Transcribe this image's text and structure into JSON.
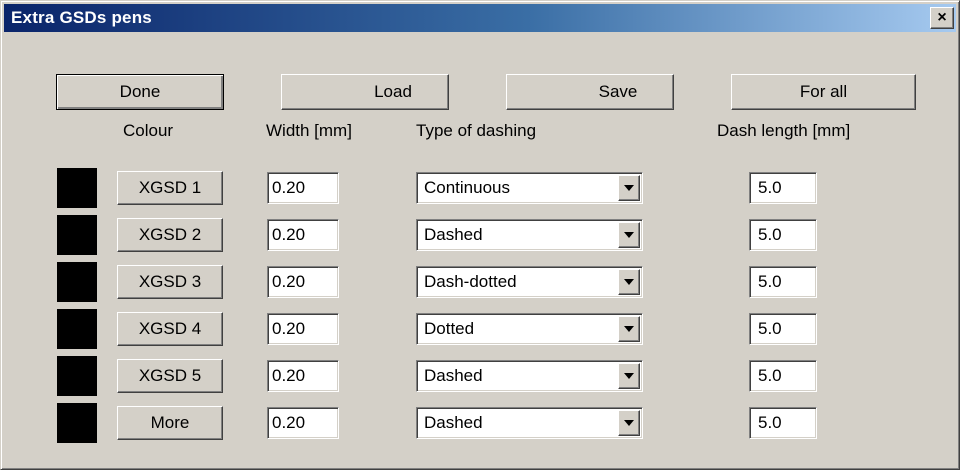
{
  "window": {
    "title": "Extra GSDs pens",
    "close_glyph": "×"
  },
  "toolbar": {
    "done": "Done",
    "load": "Load",
    "save": "Save",
    "for_all": "For all"
  },
  "headers": {
    "colour": "Colour",
    "width": "Width [mm]",
    "dashing": "Type of dashing",
    "dash_length": "Dash length [mm]"
  },
  "pens": [
    {
      "color": "#000000",
      "label": "XGSD 1",
      "width": "0.20",
      "dashing": "Continuous",
      "dash_length": "5.0"
    },
    {
      "color": "#000000",
      "label": "XGSD 2",
      "width": "0.20",
      "dashing": "Dashed",
      "dash_length": "5.0"
    },
    {
      "color": "#000000",
      "label": "XGSD 3",
      "width": "0.20",
      "dashing": "Dash-dotted",
      "dash_length": "5.0"
    },
    {
      "color": "#000000",
      "label": "XGSD 4",
      "width": "0.20",
      "dashing": "Dotted",
      "dash_length": "5.0"
    },
    {
      "color": "#000000",
      "label": "XGSD 5",
      "width": "0.20",
      "dashing": "Dashed",
      "dash_length": "5.0"
    },
    {
      "color": "#000000",
      "label": "More",
      "width": "0.20",
      "dashing": "Dashed",
      "dash_length": "5.0"
    }
  ]
}
